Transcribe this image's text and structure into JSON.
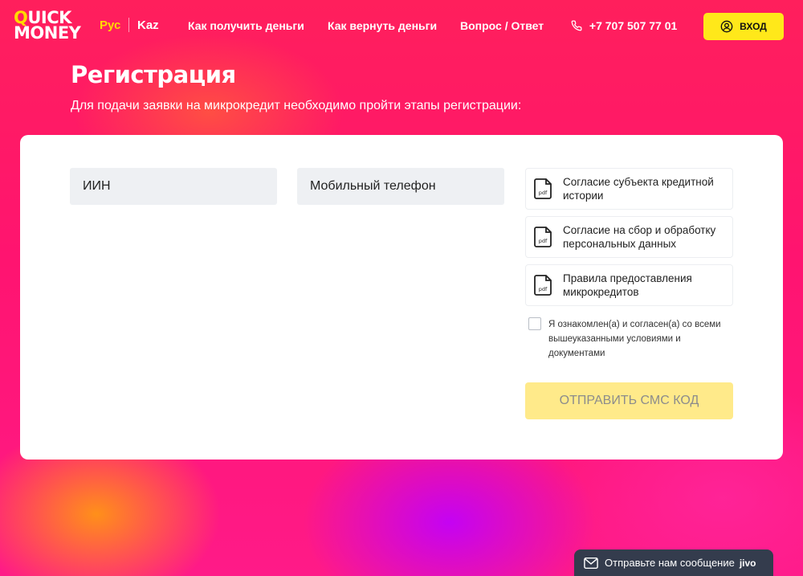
{
  "header": {
    "logo_line1": "QUICK",
    "logo_line2": "MONEY",
    "lang_ru": "Рус",
    "lang_kz": "Kaz",
    "nav": [
      {
        "label": "Как получить деньги"
      },
      {
        "label": "Как вернуть деньги"
      },
      {
        "label": "Вопрос / Ответ"
      }
    ],
    "phone": "+7 707 507 77 01",
    "login_label": "ВХОД"
  },
  "page": {
    "title": "Регистрация",
    "subtitle": "Для подачи заявки на микрокредит необходимо пройти этапы регистрации:"
  },
  "form": {
    "iin_placeholder": "ИИН",
    "phone_placeholder": "Мобильный телефон",
    "documents": [
      {
        "label": "Согласие субъекта кредитной истории",
        "icon": "pdf-icon"
      },
      {
        "label": "Согласие на сбор и обработку персональных данных",
        "icon": "pdf-icon"
      },
      {
        "label": "Правила предоставления микрокредитов",
        "icon": "pdf-icon"
      }
    ],
    "agree_label": "Я ознакомлен(а) и согласен(а) со всеми вышеуказанными условиями и документами",
    "agree_checked": false,
    "submit_label": "ОТПРАВИТЬ СМС КОД"
  },
  "chat": {
    "label": "Отправьте нам сообщение",
    "brand": "jivo"
  },
  "colors": {
    "accent_yellow": "#ffe81a",
    "brand_pink": "#ff1f5c",
    "disabled_button": "#ffea8a"
  }
}
